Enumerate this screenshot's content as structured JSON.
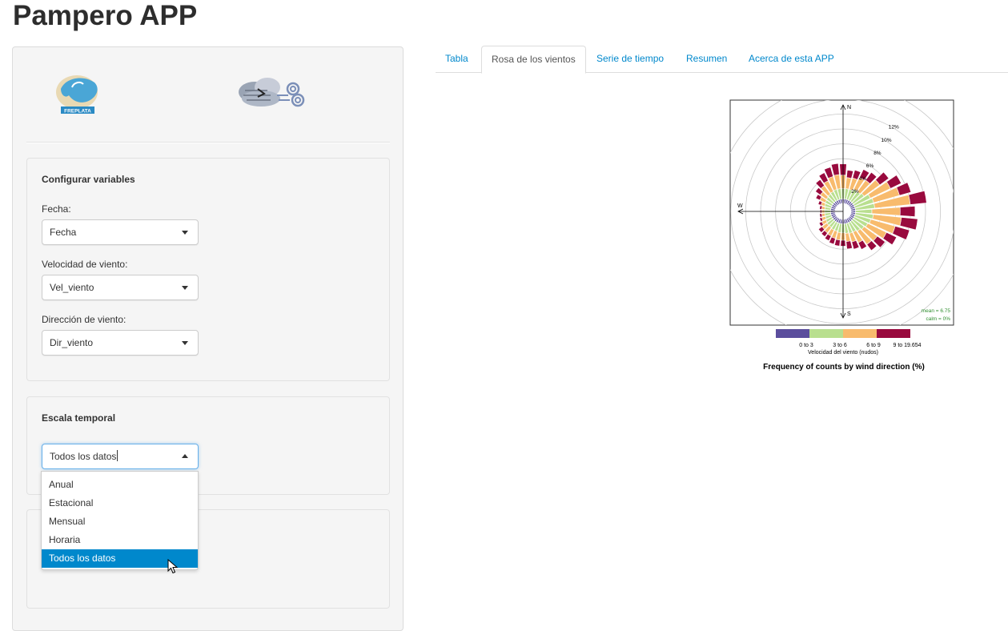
{
  "app": {
    "title": "Pampero APP"
  },
  "sidebar": {
    "logos": [
      {
        "name": "freplata-logo",
        "text": "FREPLATA"
      },
      {
        "name": "clouds-logo",
        "text": ""
      }
    ],
    "variables_panel": {
      "title": "Configurar variables",
      "fields": [
        {
          "label": "Fecha:",
          "value": "Fecha"
        },
        {
          "label": "Velocidad de viento:",
          "value": "Vel_viento"
        },
        {
          "label": "Dirección de viento:",
          "value": "Dir_viento"
        }
      ]
    },
    "temporal_panel": {
      "title": "Escala temporal",
      "value": "Todos los datos",
      "options": [
        "Anual",
        "Estacional",
        "Mensual",
        "Horaria",
        "Todos los datos"
      ],
      "selected_index": 4
    }
  },
  "tabs": [
    {
      "label": "Tabla",
      "active": false
    },
    {
      "label": "Rosa de los vientos",
      "active": true
    },
    {
      "label": "Serie de tiempo",
      "active": false
    },
    {
      "label": "Resumen",
      "active": false
    },
    {
      "label": "Acerca de esta APP",
      "active": false
    }
  ],
  "chart_data": {
    "type": "wind-rose",
    "title": "Frequency of counts by wind direction (%)",
    "legend_title": "Velocidad del viento (nudos)",
    "directions_labels": [
      "N",
      "W",
      "S"
    ],
    "radial_ticks": [
      "2%",
      "4%",
      "6%",
      "8%",
      "10%",
      "12%"
    ],
    "radial_max": 12,
    "stats": {
      "mean": "mean = 6.75",
      "calm": "calm = 0%"
    },
    "series": [
      {
        "name": "0 to 3",
        "color": "#5b4e9d"
      },
      {
        "name": "3 to 6",
        "color": "#b9df8f"
      },
      {
        "name": "6 to 9",
        "color": "#f8bb6d"
      },
      {
        "name": "9 to 19.654",
        "color": "#990a3e"
      }
    ],
    "directions": [
      0,
      10,
      20,
      30,
      40,
      50,
      60,
      70,
      80,
      90,
      100,
      110,
      120,
      130,
      140,
      150,
      160,
      170,
      180,
      190,
      200,
      210,
      220,
      230,
      240,
      250,
      260,
      270,
      280,
      290,
      300,
      310,
      320,
      330,
      340,
      350
    ],
    "values": [
      [
        0.6,
        1.4,
        1.8,
        1.5
      ],
      [
        0.6,
        1.4,
        1.5,
        1.0
      ],
      [
        0.6,
        1.4,
        1.6,
        1.1
      ],
      [
        0.6,
        1.6,
        1.8,
        1.2
      ],
      [
        0.6,
        1.6,
        1.9,
        1.3
      ],
      [
        0.6,
        1.8,
        2.6,
        1.5
      ],
      [
        0.6,
        2.4,
        3.0,
        1.6
      ],
      [
        0.6,
        2.6,
        3.6,
        1.6
      ],
      [
        0.6,
        2.6,
        4.8,
        2.2
      ],
      [
        0.6,
        2.2,
        3.8,
        2.0
      ],
      [
        0.6,
        2.4,
        3.8,
        2.2
      ],
      [
        0.6,
        2.2,
        3.4,
        2.0
      ],
      [
        0.6,
        2.0,
        2.8,
        1.5
      ],
      [
        0.6,
        1.8,
        2.2,
        1.3
      ],
      [
        0.6,
        1.6,
        2.2,
        1.0
      ],
      [
        0.6,
        1.4,
        1.6,
        1.0
      ],
      [
        0.6,
        1.4,
        1.2,
        1.0
      ],
      [
        0.6,
        1.3,
        1.1,
        1.0
      ],
      [
        0.6,
        1.2,
        1.0,
        0.8
      ],
      [
        0.6,
        1.2,
        1.0,
        0.8
      ],
      [
        0.6,
        1.1,
        1.0,
        0.8
      ],
      [
        0.6,
        1.1,
        0.9,
        0.7
      ],
      [
        0.6,
        1.0,
        0.9,
        0.6
      ],
      [
        0.6,
        1.0,
        0.8,
        0.6
      ],
      [
        0.6,
        0.9,
        0.6,
        0.4
      ],
      [
        0.6,
        0.8,
        0.5,
        0.3
      ],
      [
        0.6,
        0.8,
        0.4,
        0.3
      ],
      [
        0.6,
        0.8,
        0.4,
        0.2
      ],
      [
        0.6,
        0.8,
        0.4,
        0.3
      ],
      [
        0.6,
        0.9,
        0.5,
        0.4
      ],
      [
        0.6,
        1.0,
        0.8,
        0.6
      ],
      [
        0.6,
        1.1,
        1.0,
        0.8
      ],
      [
        0.6,
        1.2,
        1.4,
        1.0
      ],
      [
        0.6,
        1.3,
        1.6,
        1.2
      ],
      [
        0.6,
        1.4,
        1.8,
        1.3
      ],
      [
        0.6,
        1.4,
        1.9,
        1.5
      ]
    ]
  }
}
